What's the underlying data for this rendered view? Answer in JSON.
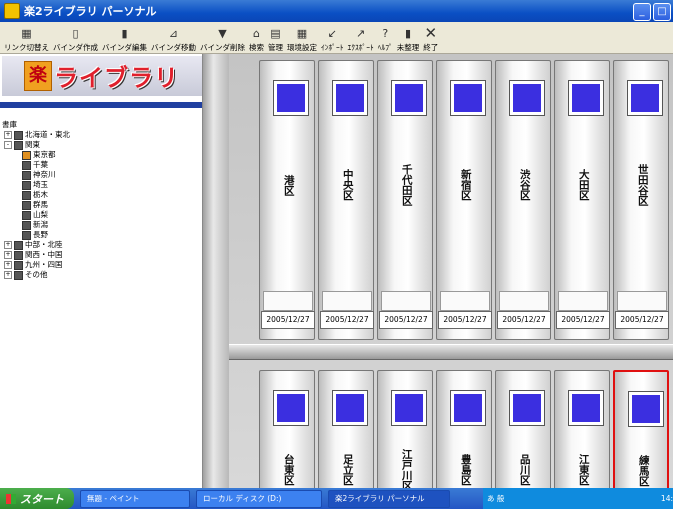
{
  "window": {
    "title": "楽2ライブラリ パーソナル"
  },
  "toolbar": [
    {
      "label": "リンク切替え",
      "icon": "grid-icon"
    },
    {
      "label": "バインダ作成",
      "icon": "binder-new-icon"
    },
    {
      "label": "バインダ編集",
      "icon": "binder-edit-icon"
    },
    {
      "label": "バインダ移動",
      "icon": "binder-move-icon"
    },
    {
      "label": "バインダ削除",
      "icon": "binder-delete-icon"
    },
    {
      "label": "検索",
      "icon": "search-icon"
    },
    {
      "label": "管理",
      "icon": "manage-icon"
    },
    {
      "label": "環境設定",
      "icon": "settings-icon"
    },
    {
      "label": "ｲﾝﾎﾟｰﾄ",
      "icon": "import-icon"
    },
    {
      "label": "ｴｸｽﾎﾟｰﾄ",
      "icon": "export-icon"
    },
    {
      "label": "ﾍﾙﾌﾟ",
      "icon": "help-icon"
    },
    {
      "label": "未整理",
      "icon": "unsorted-icon"
    },
    {
      "label": "終了",
      "icon": "close-icon"
    }
  ],
  "logo": {
    "mark": "楽",
    "name": "ライブラリ"
  },
  "tree": {
    "root": "書庫",
    "items": [
      {
        "label": "北海道・東北",
        "level": 1,
        "expander": "+"
      },
      {
        "label": "関東",
        "level": 1,
        "expander": "-"
      },
      {
        "label": "東京都",
        "level": 2,
        "selected": true
      },
      {
        "label": "千葉",
        "level": 2
      },
      {
        "label": "神奈川",
        "level": 2
      },
      {
        "label": "埼玉",
        "level": 2
      },
      {
        "label": "栃木",
        "level": 2
      },
      {
        "label": "群馬",
        "level": 2
      },
      {
        "label": "山梨",
        "level": 2
      },
      {
        "label": "新潟",
        "level": 2
      },
      {
        "label": "長野",
        "level": 2
      },
      {
        "label": "中部・北陸",
        "level": 1,
        "expander": "+"
      },
      {
        "label": "関西・中国",
        "level": 1,
        "expander": "+"
      },
      {
        "label": "九州・四国",
        "level": 1,
        "expander": "+"
      },
      {
        "label": "その他",
        "level": 1,
        "expander": "+"
      }
    ]
  },
  "shelf_top": [
    {
      "name": "港区",
      "date": "2005/12/27"
    },
    {
      "name": "中央区",
      "date": "2005/12/27"
    },
    {
      "name": "千代田区",
      "date": "2005/12/27"
    },
    {
      "name": "新宿区",
      "date": "2005/12/27"
    },
    {
      "name": "渋谷区",
      "date": "2005/12/27"
    },
    {
      "name": "大田区",
      "date": "2005/12/27"
    },
    {
      "name": "世田谷区",
      "date": "2005/12/27"
    }
  ],
  "shelf_bottom": [
    {
      "name": "台東区"
    },
    {
      "name": "足立区"
    },
    {
      "name": "江戸川区"
    },
    {
      "name": "豊島区"
    },
    {
      "name": "品川区"
    },
    {
      "name": "江東区"
    },
    {
      "name": "練馬区",
      "active": true
    }
  ],
  "taskbar": {
    "start": "スタート",
    "tasks": [
      "無題 - ペイント",
      "ローカル ディスク (D:)",
      "楽2ライブラリ パーソナル"
    ],
    "tray_text": "あ 般",
    "clock": "14:"
  }
}
